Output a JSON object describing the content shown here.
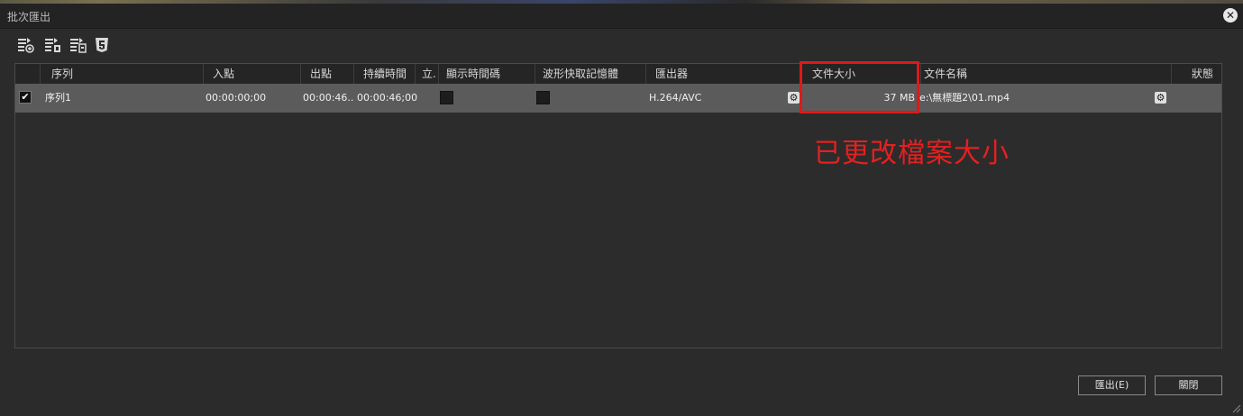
{
  "window": {
    "title": "批次匯出",
    "close_icon": "close-icon"
  },
  "toolbar": {
    "buttons": [
      {
        "icon": "add-to-queue-icon"
      },
      {
        "icon": "add-sequence-icon"
      },
      {
        "icon": "remove-from-queue-icon"
      },
      {
        "icon": "html5-icon"
      }
    ]
  },
  "table": {
    "columns": [
      "序列",
      "入點",
      "出點",
      "持續時間",
      "立.",
      "顯示時間碼",
      "波形快取記憶體",
      "匯出器",
      "文件大小",
      "文件名稱",
      "狀態"
    ],
    "rows": [
      {
        "checked": true,
        "sequence": "序列1",
        "in_point": "00:00:00;00",
        "out_point": "00:00:46...",
        "duration": "00:00:46;00",
        "show_timecode": false,
        "waveform_cache": false,
        "exporter": "H.264/AVC",
        "file_size": "37 MB",
        "file_name": "e:\\無標題2\\01.mp4",
        "status": ""
      }
    ]
  },
  "annotation": {
    "text": "已更改檔案大小",
    "color": "#e52020"
  },
  "buttons": {
    "export": "匯出(E)",
    "close": "關閉"
  }
}
